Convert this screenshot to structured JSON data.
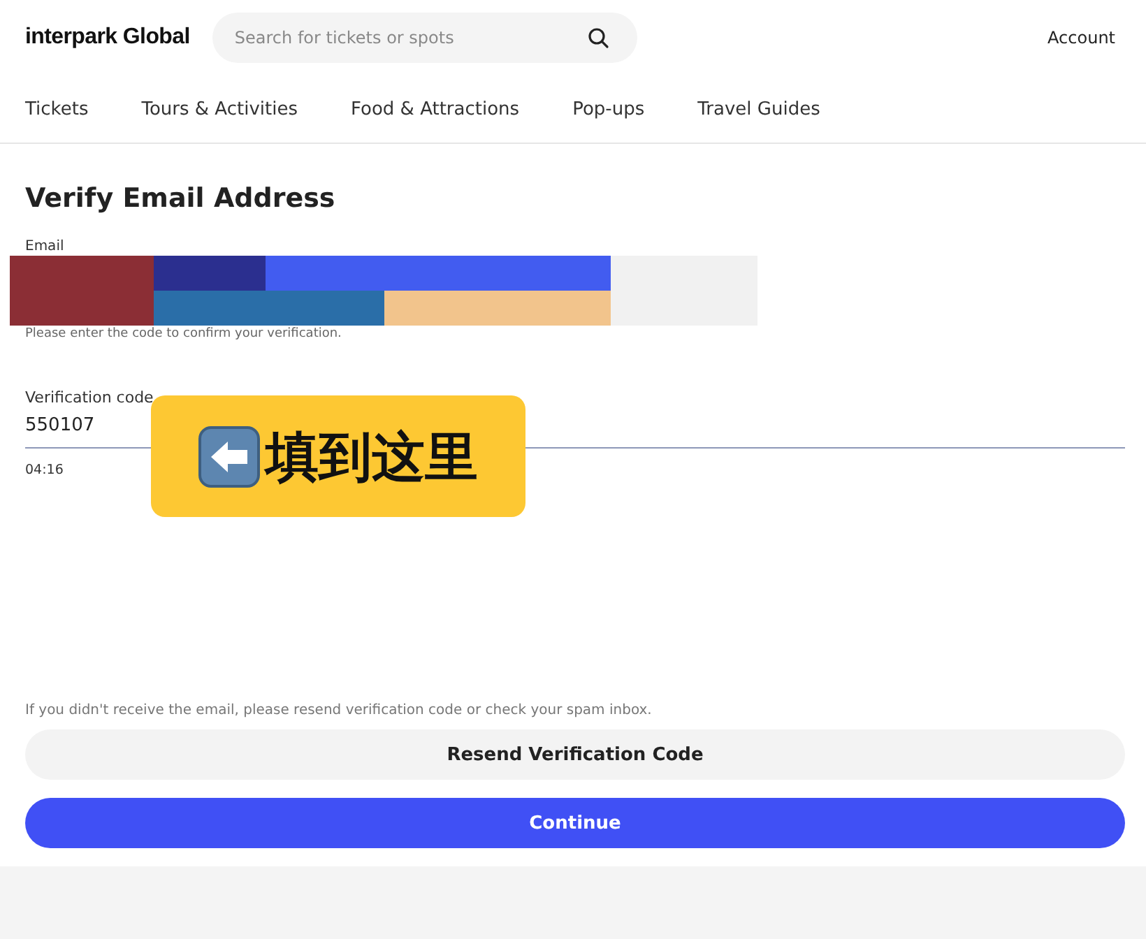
{
  "header": {
    "logo": "interpark Global",
    "search": {
      "placeholder": "Search for tickets or spots"
    },
    "account": "Account"
  },
  "nav": [
    {
      "label": "Tickets"
    },
    {
      "label": "Tours & Activities"
    },
    {
      "label": "Food & Attractions"
    },
    {
      "label": "Pop-ups"
    },
    {
      "label": "Travel Guides"
    }
  ],
  "page": {
    "title": "Verify Email Address",
    "email_label": "Email",
    "hint": "Please enter the code to confirm your verification.",
    "code": {
      "label": "Verification code",
      "value": "550107",
      "timer": "04:16"
    },
    "notice": "If you didn't receive the email, please resend verification code or check your spam inbox.",
    "buttons": [
      {
        "label": "Resend Verification Code",
        "kind": "secondary"
      },
      {
        "label": "Continue",
        "kind": "primary"
      }
    ]
  },
  "callout": {
    "text": "填到这里"
  }
}
